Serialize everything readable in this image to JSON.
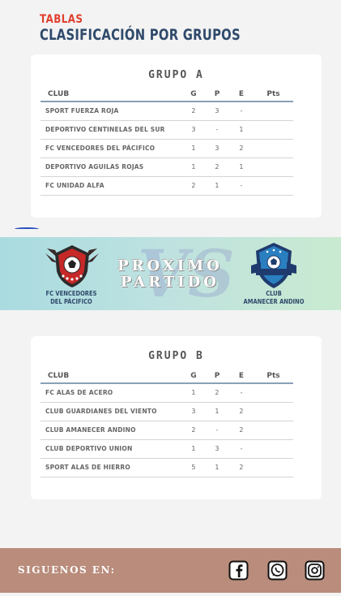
{
  "header": {
    "kicker": "TABLAS",
    "title": "CLASIFICACIÓN POR GRUPOS"
  },
  "columns": {
    "club": "CLUB",
    "g": "G",
    "p": "P",
    "e": "E",
    "pts": "Pts"
  },
  "group_a": {
    "title": "GRUPO   A",
    "rows": [
      {
        "club": "SPORT FUERZA ROJA",
        "g": "2",
        "p": "3",
        "e": "-",
        "pts": ""
      },
      {
        "club": "DEPORTIVO CENTINELAS DEL SUR",
        "g": "3",
        "p": "-",
        "e": "1",
        "pts": ""
      },
      {
        "club": "FC VENCEDORES DEL PÁCIFICO",
        "g": "1",
        "p": "3",
        "e": "2",
        "pts": ""
      },
      {
        "club": "DEPORTIVO AGUILAS ROJAS",
        "g": "1",
        "p": "2",
        "e": "1",
        "pts": ""
      },
      {
        "club": "FC UNIDAD ALFA",
        "g": "2",
        "p": "1",
        "e": "-",
        "pts": ""
      }
    ]
  },
  "banner": {
    "next_line1": "PROXIMO",
    "next_line2": "PARTIDO",
    "vs": "VS",
    "left_team_line1": "FC VENCEDORES",
    "left_team_line2": "DEL PÁCIFICO",
    "right_team_line1": "CLUB",
    "right_team_line2": "AMANECER ANDINO"
  },
  "group_b": {
    "title": "GRUPO   B",
    "rows": [
      {
        "club": "FC ALAS DE ACERO",
        "g": "1",
        "p": "2",
        "e": "-",
        "pts": ""
      },
      {
        "club": "CLUB GUARDIANES DEL VIENTO",
        "g": "3",
        "p": "1",
        "e": "2",
        "pts": ""
      },
      {
        "club": "CLUB AMANECER ANDINO",
        "g": "2",
        "p": "-",
        "e": "2",
        "pts": ""
      },
      {
        "club": "CLUB DEPORTIVO UNION",
        "g": "1",
        "p": "3",
        "e": "-",
        "pts": ""
      },
      {
        "club": "SPORT ALAS DE HIERRO",
        "g": "5",
        "p": "1",
        "e": "2",
        "pts": ""
      }
    ]
  },
  "footer": {
    "follow": "SIGUENOS EN:",
    "social_icons": [
      "facebook-icon",
      "whatsapp-icon",
      "instagram-icon"
    ]
  },
  "colors": {
    "accent_red": "#e0402f",
    "title_blue": "#2f4a6b",
    "footer_bg": "#b98c7c"
  }
}
